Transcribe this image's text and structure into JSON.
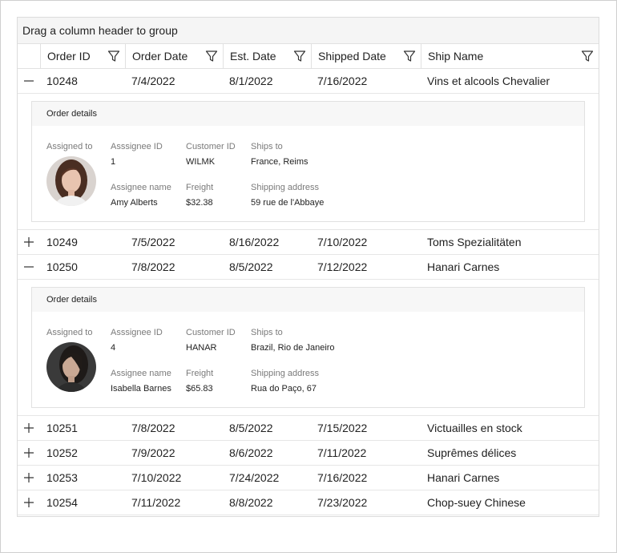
{
  "group_panel": {
    "text": "Drag a column header to group"
  },
  "columns": {
    "order_id": "Order ID",
    "order_date": "Order Date",
    "est_date": "Est. Date",
    "shipped_date": "Shipped Date",
    "ship_name": "Ship Name"
  },
  "icons": {
    "filter": "filter-icon",
    "expand": "plus-icon",
    "collapse": "minus-icon"
  },
  "labels": {
    "details_title": "Order details",
    "assigned_to": "Assigned to",
    "assignee_id": "Asssignee ID",
    "customer_id": "Customer ID",
    "ships_to": "Ships to",
    "assignee_name": "Assignee name",
    "freight": "Freight",
    "shipping_address": "Shipping address"
  },
  "rows": [
    {
      "expanded": true,
      "order_id": "10248",
      "order_date": "7/4/2022",
      "est_date": "8/1/2022",
      "shipped_date": "7/16/2022",
      "ship_name": "Vins et alcools Chevalier",
      "details": {
        "assignee_id": "1",
        "customer_id": "WILMK",
        "ships_to": "France, Reims",
        "assignee_name": "Amy Alberts",
        "freight": "$32.38",
        "shipping_address": "59 rue de l'Abbaye"
      }
    },
    {
      "expanded": false,
      "order_id": "10249",
      "order_date": "7/5/2022",
      "est_date": "8/16/2022",
      "shipped_date": "7/10/2022",
      "ship_name": "Toms Spezialitäten"
    },
    {
      "expanded": true,
      "order_id": "10250",
      "order_date": "7/8/2022",
      "est_date": "8/5/2022",
      "shipped_date": "7/12/2022",
      "ship_name": "Hanari Carnes",
      "details": {
        "assignee_id": "4",
        "customer_id": "HANAR",
        "ships_to": "Brazil, Rio de Janeiro",
        "assignee_name": "Isabella Barnes",
        "freight": "$65.83",
        "shipping_address": "Rua do Paço, 67"
      }
    },
    {
      "expanded": false,
      "order_id": "10251",
      "order_date": "7/8/2022",
      "est_date": "8/5/2022",
      "shipped_date": "7/15/2022",
      "ship_name": "Victuailles en stock"
    },
    {
      "expanded": false,
      "order_id": "10252",
      "order_date": "7/9/2022",
      "est_date": "8/6/2022",
      "shipped_date": "7/11/2022",
      "ship_name": "Suprêmes délices"
    },
    {
      "expanded": false,
      "order_id": "10253",
      "order_date": "7/10/2022",
      "est_date": "7/24/2022",
      "shipped_date": "7/16/2022",
      "ship_name": "Hanari Carnes"
    },
    {
      "expanded": false,
      "order_id": "10254",
      "order_date": "7/11/2022",
      "est_date": "8/8/2022",
      "shipped_date": "7/23/2022",
      "ship_name": "Chop-suey Chinese"
    }
  ]
}
